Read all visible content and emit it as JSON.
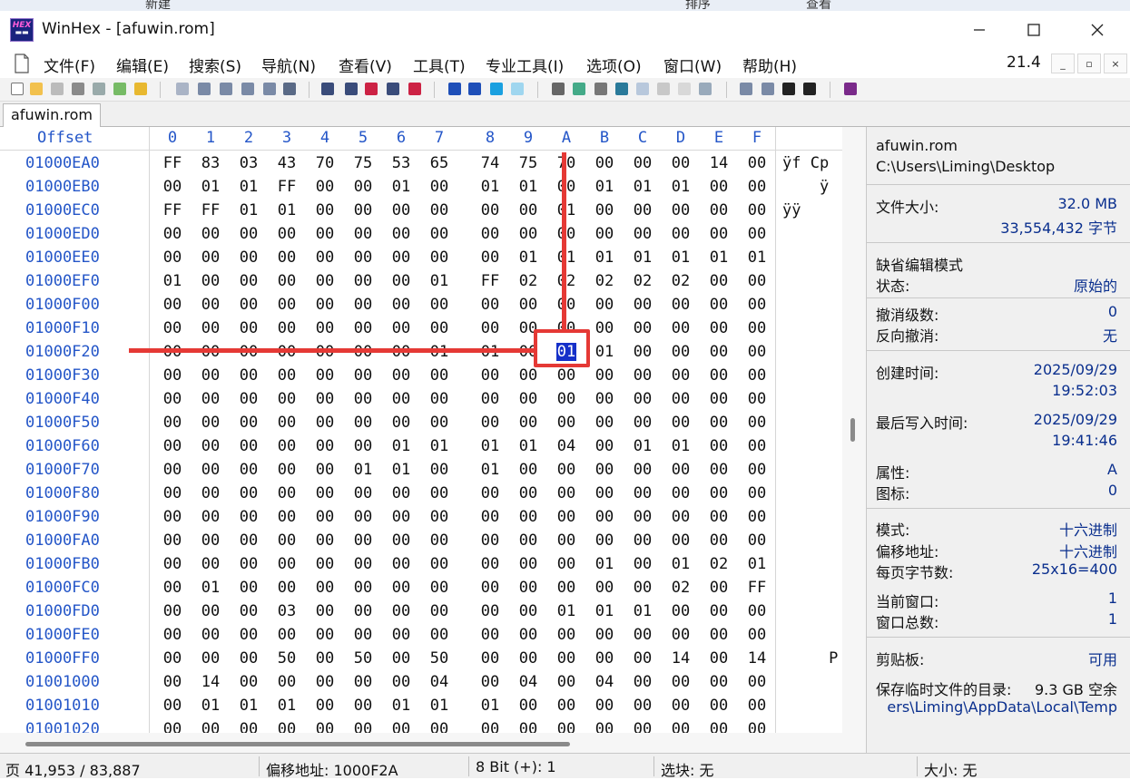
{
  "window": {
    "title": "WinHex - [afuwin.rom]",
    "logo_text": "HEX"
  },
  "bleed_labels": [
    "新建",
    "排序",
    "查看"
  ],
  "menu": {
    "items": [
      "文件(F)",
      "编辑(E)",
      "搜索(S)",
      "导航(N)",
      "查看(V)",
      "工具(T)",
      "专业工具(I)",
      "选项(O)",
      "窗口(W)",
      "帮助(H)"
    ],
    "version": "21.4"
  },
  "tab": {
    "label": "afuwin.rom"
  },
  "hex": {
    "offset_header": "Offset",
    "columns": [
      "0",
      "1",
      "2",
      "3",
      "4",
      "5",
      "6",
      "7",
      "8",
      "9",
      "A",
      "B",
      "C",
      "D",
      "E",
      "F"
    ],
    "rows": [
      {
        "offset": "01000EA0",
        "bytes": [
          "FF",
          "83",
          "03",
          "43",
          "70",
          "75",
          "53",
          "65",
          "74",
          "75",
          "70",
          "00",
          "00",
          "00",
          "14",
          "00"
        ],
        "ascii": "ÿf Cp"
      },
      {
        "offset": "01000EB0",
        "bytes": [
          "00",
          "01",
          "01",
          "FF",
          "00",
          "00",
          "01",
          "00",
          "01",
          "01",
          "00",
          "01",
          "01",
          "01",
          "00",
          "00"
        ],
        "ascii": "    ÿ"
      },
      {
        "offset": "01000EC0",
        "bytes": [
          "FF",
          "FF",
          "01",
          "01",
          "00",
          "00",
          "00",
          "00",
          "00",
          "00",
          "01",
          "00",
          "00",
          "00",
          "00",
          "00"
        ],
        "ascii": "ÿÿ"
      },
      {
        "offset": "01000ED0",
        "bytes": [
          "00",
          "00",
          "00",
          "00",
          "00",
          "00",
          "00",
          "00",
          "00",
          "00",
          "00",
          "00",
          "00",
          "00",
          "00",
          "00"
        ],
        "ascii": ""
      },
      {
        "offset": "01000EE0",
        "bytes": [
          "00",
          "00",
          "00",
          "00",
          "00",
          "00",
          "00",
          "00",
          "00",
          "01",
          "01",
          "01",
          "01",
          "01",
          "01",
          "01"
        ],
        "ascii": ""
      },
      {
        "offset": "01000EF0",
        "bytes": [
          "01",
          "00",
          "00",
          "00",
          "00",
          "00",
          "00",
          "01",
          "FF",
          "02",
          "02",
          "02",
          "02",
          "02",
          "00",
          "00"
        ],
        "ascii": ""
      },
      {
        "offset": "01000F00",
        "bytes": [
          "00",
          "00",
          "00",
          "00",
          "00",
          "00",
          "00",
          "00",
          "00",
          "00",
          "00",
          "00",
          "00",
          "00",
          "00",
          "00"
        ],
        "ascii": ""
      },
      {
        "offset": "01000F10",
        "bytes": [
          "00",
          "00",
          "00",
          "00",
          "00",
          "00",
          "00",
          "00",
          "00",
          "00",
          "00",
          "00",
          "00",
          "00",
          "00",
          "00"
        ],
        "ascii": ""
      },
      {
        "offset": "01000F20",
        "bytes": [
          "00",
          "00",
          "00",
          "00",
          "00",
          "00",
          "00",
          "01",
          "01",
          "00",
          "01",
          "01",
          "00",
          "00",
          "00",
          "00"
        ],
        "ascii": ""
      },
      {
        "offset": "01000F30",
        "bytes": [
          "00",
          "00",
          "00",
          "00",
          "00",
          "00",
          "00",
          "00",
          "00",
          "00",
          "00",
          "00",
          "00",
          "00",
          "00",
          "00"
        ],
        "ascii": ""
      },
      {
        "offset": "01000F40",
        "bytes": [
          "00",
          "00",
          "00",
          "00",
          "00",
          "00",
          "00",
          "00",
          "00",
          "00",
          "00",
          "00",
          "00",
          "00",
          "00",
          "00"
        ],
        "ascii": ""
      },
      {
        "offset": "01000F50",
        "bytes": [
          "00",
          "00",
          "00",
          "00",
          "00",
          "00",
          "00",
          "00",
          "00",
          "00",
          "00",
          "00",
          "00",
          "00",
          "00",
          "00"
        ],
        "ascii": ""
      },
      {
        "offset": "01000F60",
        "bytes": [
          "00",
          "00",
          "00",
          "00",
          "00",
          "00",
          "01",
          "01",
          "01",
          "01",
          "04",
          "00",
          "01",
          "01",
          "00",
          "00"
        ],
        "ascii": ""
      },
      {
        "offset": "01000F70",
        "bytes": [
          "00",
          "00",
          "00",
          "00",
          "00",
          "01",
          "01",
          "00",
          "01",
          "00",
          "00",
          "00",
          "00",
          "00",
          "00",
          "00"
        ],
        "ascii": ""
      },
      {
        "offset": "01000F80",
        "bytes": [
          "00",
          "00",
          "00",
          "00",
          "00",
          "00",
          "00",
          "00",
          "00",
          "00",
          "00",
          "00",
          "00",
          "00",
          "00",
          "00"
        ],
        "ascii": ""
      },
      {
        "offset": "01000F90",
        "bytes": [
          "00",
          "00",
          "00",
          "00",
          "00",
          "00",
          "00",
          "00",
          "00",
          "00",
          "00",
          "00",
          "00",
          "00",
          "00",
          "00"
        ],
        "ascii": ""
      },
      {
        "offset": "01000FA0",
        "bytes": [
          "00",
          "00",
          "00",
          "00",
          "00",
          "00",
          "00",
          "00",
          "00",
          "00",
          "00",
          "00",
          "00",
          "00",
          "00",
          "00"
        ],
        "ascii": ""
      },
      {
        "offset": "01000FB0",
        "bytes": [
          "00",
          "00",
          "00",
          "00",
          "00",
          "00",
          "00",
          "00",
          "00",
          "00",
          "00",
          "01",
          "00",
          "01",
          "02",
          "01"
        ],
        "ascii": ""
      },
      {
        "offset": "01000FC0",
        "bytes": [
          "00",
          "01",
          "00",
          "00",
          "00",
          "00",
          "00",
          "00",
          "00",
          "00",
          "00",
          "00",
          "00",
          "02",
          "00",
          "FF"
        ],
        "ascii": ""
      },
      {
        "offset": "01000FD0",
        "bytes": [
          "00",
          "00",
          "00",
          "03",
          "00",
          "00",
          "00",
          "00",
          "00",
          "00",
          "01",
          "01",
          "01",
          "00",
          "00",
          "00"
        ],
        "ascii": ""
      },
      {
        "offset": "01000FE0",
        "bytes": [
          "00",
          "00",
          "00",
          "00",
          "00",
          "00",
          "00",
          "00",
          "00",
          "00",
          "00",
          "00",
          "00",
          "00",
          "00",
          "00"
        ],
        "ascii": ""
      },
      {
        "offset": "01000FF0",
        "bytes": [
          "00",
          "00",
          "00",
          "50",
          "00",
          "50",
          "00",
          "50",
          "00",
          "00",
          "00",
          "00",
          "00",
          "14",
          "00",
          "14"
        ],
        "ascii": "     P"
      },
      {
        "offset": "01001000",
        "bytes": [
          "00",
          "14",
          "00",
          "00",
          "00",
          "00",
          "00",
          "04",
          "00",
          "04",
          "00",
          "04",
          "00",
          "00",
          "00",
          "00"
        ],
        "ascii": ""
      },
      {
        "offset": "01001010",
        "bytes": [
          "00",
          "01",
          "01",
          "01",
          "00",
          "00",
          "01",
          "01",
          "01",
          "00",
          "00",
          "00",
          "00",
          "00",
          "00",
          "00"
        ],
        "ascii": ""
      },
      {
        "offset": "01001020",
        "bytes": [
          "00",
          "00",
          "00",
          "00",
          "00",
          "00",
          "00",
          "00",
          "00",
          "00",
          "00",
          "00",
          "00",
          "00",
          "00",
          "00"
        ],
        "ascii": ""
      }
    ]
  },
  "info": {
    "file_name": "afuwin.rom",
    "file_path": "C:\\Users\\Liming\\Desktop",
    "file_size_label": "文件大小:",
    "file_size_mb": "32.0 MB",
    "file_size_bytes": "33,554,432 字节",
    "default_edit_mode": "缺省编辑模式",
    "state_label": "状态:",
    "state_value": "原始的",
    "undo_level_label": "撤消级数:",
    "undo_level_value": "0",
    "redo_label": "反向撤消:",
    "redo_value": "无",
    "created_label": "创建时间:",
    "created_date": "2025/09/29",
    "created_time": "19:52:03",
    "modified_label": "最后写入时间:",
    "modified_date": "2025/09/29",
    "modified_time": "19:41:46",
    "attr_label": "属性:",
    "attr_value": "A",
    "icon_label": "图标:",
    "icon_value": "0",
    "mode_label": "模式:",
    "mode_value": "十六进制",
    "offset_label": "偏移地址:",
    "offset_value": "十六进制",
    "bytes_per_page_label": "每页字节数:",
    "bytes_per_page_value": "25x16=400",
    "current_window_label": "当前窗口:",
    "current_window_value": "1",
    "total_windows_label": "窗口总数:",
    "total_windows_value": "1",
    "clipboard_label": "剪贴板:",
    "clipboard_value": "可用",
    "temp_dir_label": "保存临时文件的目录:",
    "temp_free": "9.3 GB 空余",
    "temp_path": "ers\\Liming\\AppData\\Local\\Temp"
  },
  "status": {
    "page": "页 41,953 / 83,887",
    "offset": "偏移地址: 1000F2A",
    "bit": "8 Bit (+): 1",
    "selection": "选块: 无",
    "size": "大小: 无"
  },
  "selection": {
    "row": 8,
    "col": 10
  },
  "colors": {
    "accent_blue": "#2456c8",
    "annotation_red": "#e53935",
    "selection": "#1530c9"
  }
}
